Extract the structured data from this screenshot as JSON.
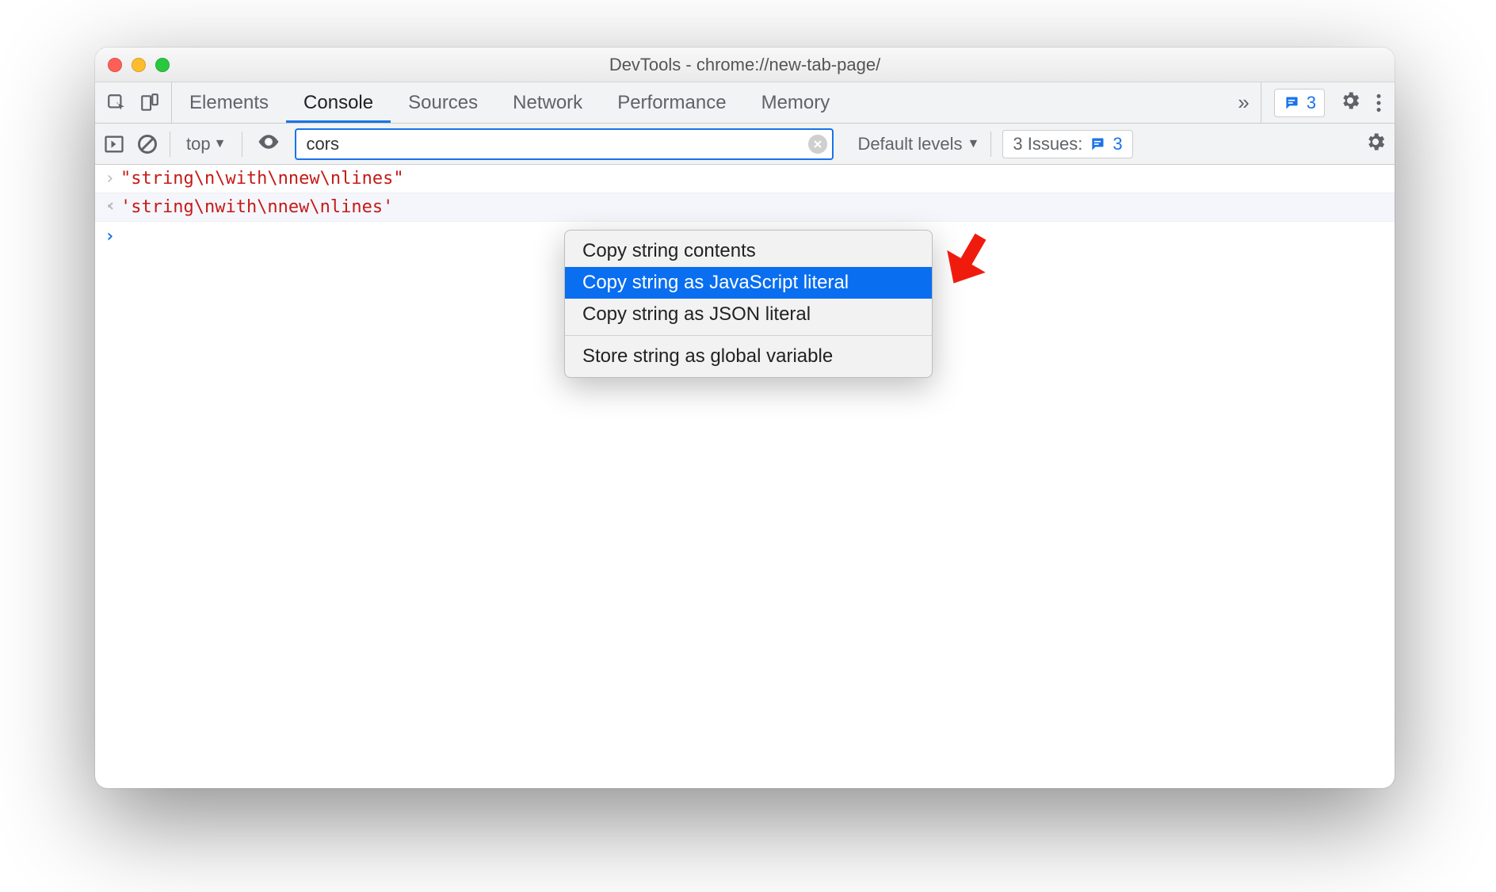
{
  "window": {
    "title": "DevTools - chrome://new-tab-page/"
  },
  "tabs": {
    "items": [
      {
        "label": "Elements",
        "active": false
      },
      {
        "label": "Console",
        "active": true
      },
      {
        "label": "Sources",
        "active": false
      },
      {
        "label": "Network",
        "active": false
      },
      {
        "label": "Performance",
        "active": false
      },
      {
        "label": "Memory",
        "active": false
      }
    ],
    "overflow_glyph": "»",
    "message_count": "3"
  },
  "toolbar": {
    "context_label": "top",
    "filter_value": "cors",
    "levels_label": "Default levels",
    "issues_label": "3 Issues:",
    "issues_count": "3"
  },
  "console": {
    "rows": [
      {
        "kind": "out",
        "arrow": "›",
        "text": "\"string\\n\\with\\nnew\\nlines\""
      },
      {
        "kind": "in",
        "arrow": "‹",
        "text": "'string\\nwith\\nnew\\nlines'"
      }
    ],
    "prompt_glyph": "›"
  },
  "context_menu": {
    "items": [
      {
        "label": "Copy string contents",
        "selected": false
      },
      {
        "label": "Copy string as JavaScript literal",
        "selected": true
      },
      {
        "label": "Copy string as JSON literal",
        "selected": false
      }
    ],
    "items2": [
      {
        "label": "Store string as global variable",
        "selected": false
      }
    ]
  }
}
